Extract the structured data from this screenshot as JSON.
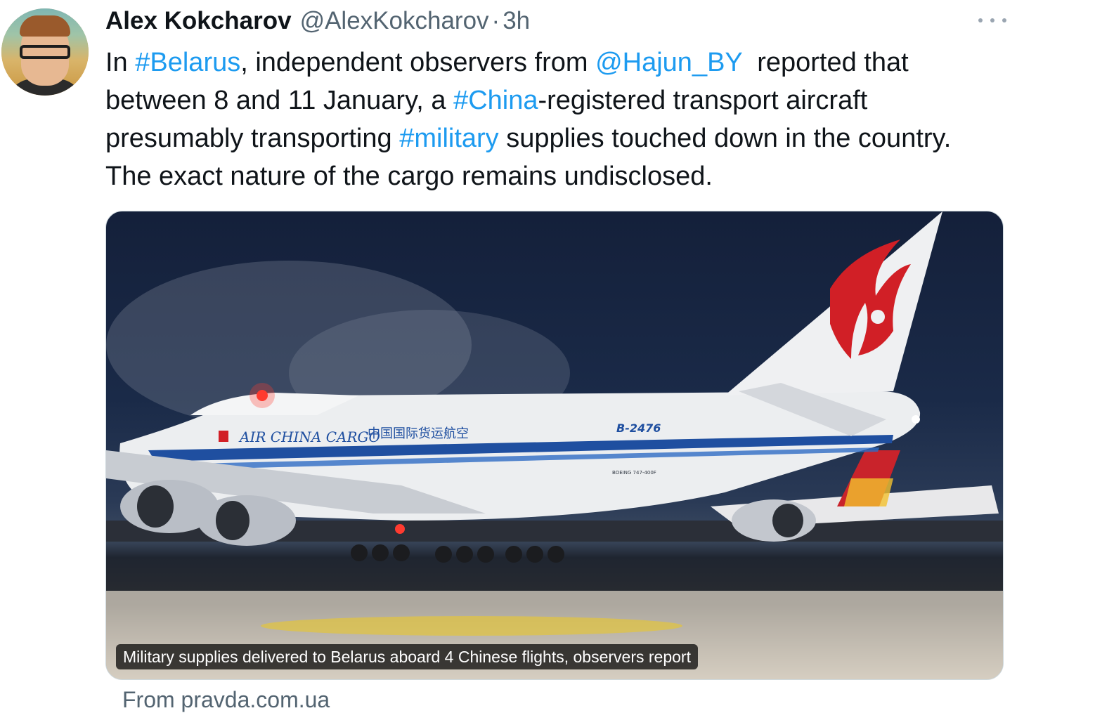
{
  "author": {
    "name": "Alex Kokcharov",
    "handle": "@AlexKokcharov",
    "separator": "·",
    "time": "3h"
  },
  "tweet": {
    "t1": "In ",
    "h1": "#Belarus",
    "t2": ", independent observers from ",
    "m1": "@Hajun_BY",
    "t3": "  reported that between 8 and 11 January, a ",
    "h2": "#China",
    "t4": "-registered transport aircraft presumably transporting ",
    "h3": "#military",
    "t5": " supplies touched down in the country. The exact nature of the cargo remains undisclosed."
  },
  "media": {
    "caption": "Military supplies delivered to Belarus aboard 4 Chinese flights, observers report",
    "livery_text": "AIR CHINA CARGO",
    "chinese_text": "中国国际货运航空",
    "registration": "B-2476",
    "model_text": "BOEING 747-400F"
  },
  "source_text": "From pravda.com.ua",
  "icons": {
    "more": "more-horizontal-icon"
  }
}
